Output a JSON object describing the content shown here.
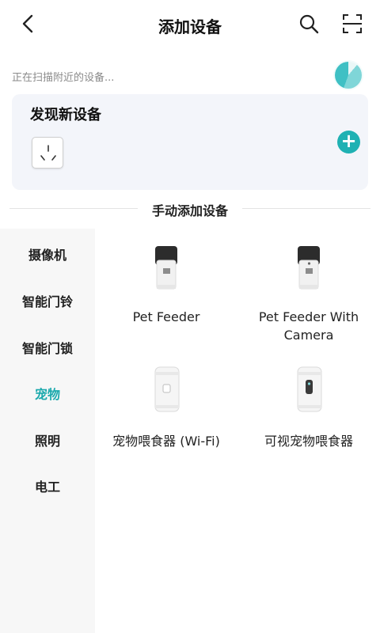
{
  "header": {
    "title": "添加设备",
    "back_icon": "chevron-left-icon",
    "search_icon": "search-icon",
    "scan_icon": "scan-icon"
  },
  "scanning": {
    "text": "正在扫描附近的设备..."
  },
  "discovered": {
    "title": "发现新设备",
    "device_icon": "smart-socket-icon",
    "add_icon": "plus-circle-icon",
    "accent_color": "#1fb1b3"
  },
  "manual": {
    "title": "手动添加设备"
  },
  "categories": [
    {
      "label": "摄像机"
    },
    {
      "label": "智能门铃"
    },
    {
      "label": "智能门锁"
    },
    {
      "label": "宠物"
    },
    {
      "label": "照明"
    },
    {
      "label": "电工"
    }
  ],
  "active_category": "宠物",
  "products": [
    {
      "name": "Pet Feeder",
      "icon": "pet-feeder-icon"
    },
    {
      "name": "Pet Feeder With Camera",
      "icon": "pet-feeder-camera-icon"
    },
    {
      "name": "宠物喂食器 (Wi-Fi)",
      "icon": "wifi-pet-feeder-icon"
    },
    {
      "name": "可视宠物喂食器",
      "icon": "video-pet-feeder-icon"
    }
  ],
  "colors": {
    "accent": "#1ba9ad",
    "card_bg": "#f3f5fa",
    "sidebar_bg": "#f7f7f7"
  }
}
